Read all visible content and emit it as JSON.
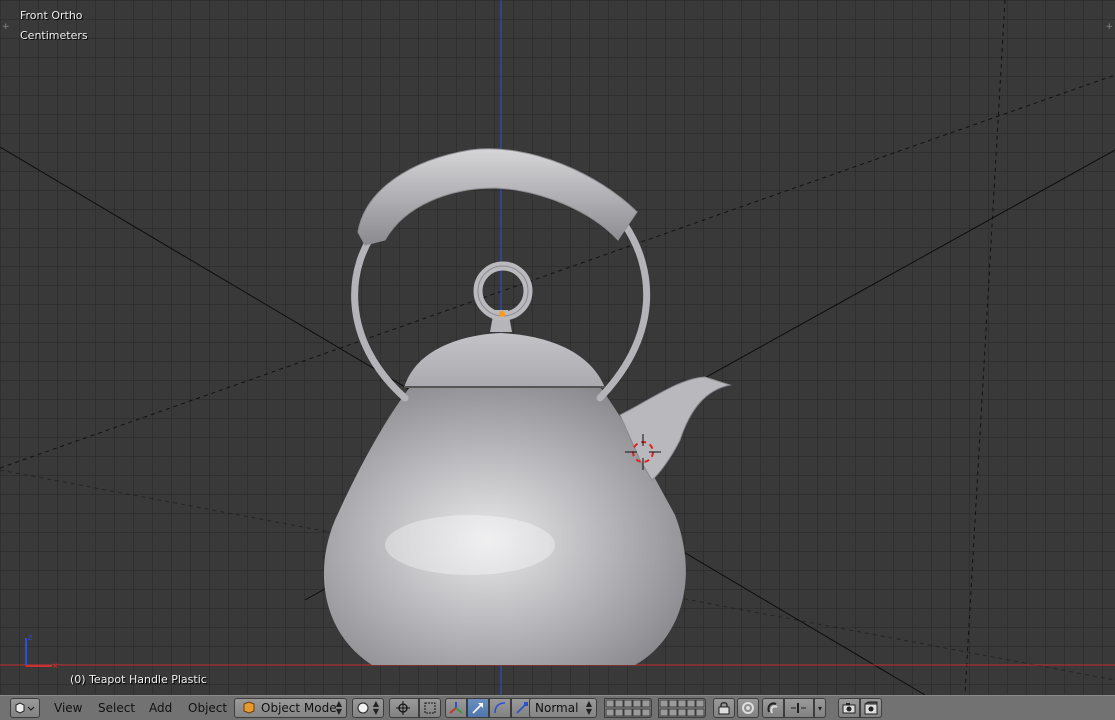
{
  "viewport": {
    "view_name": "Front Ortho",
    "units": "Centimeters",
    "object_info": "(0) Teapot Handle Plastic",
    "axis_labels": {
      "z": "z",
      "x": "x"
    }
  },
  "header": {
    "menus": [
      "View",
      "Select",
      "Add",
      "Object"
    ],
    "mode": "Object Mode",
    "orientation": "Normal",
    "icons": [
      "editor-type-icon",
      "viewport-shading-icon",
      "pivot-point-icon",
      "manipulator-toggle-icon",
      "translate-icon",
      "rotate-icon",
      "scale-icon",
      "layers-icon",
      "lock-icon",
      "proportional-edit-icon",
      "snap-icon",
      "snap-element-icon",
      "opengl-render-icon",
      "opengl-animation-icon"
    ]
  },
  "colors": {
    "viewport_bg": "#393939",
    "header_bg": "#727272",
    "z_axis": "#2d4fd6",
    "x_axis": "#c83232",
    "active_blue": "#5680c2"
  }
}
